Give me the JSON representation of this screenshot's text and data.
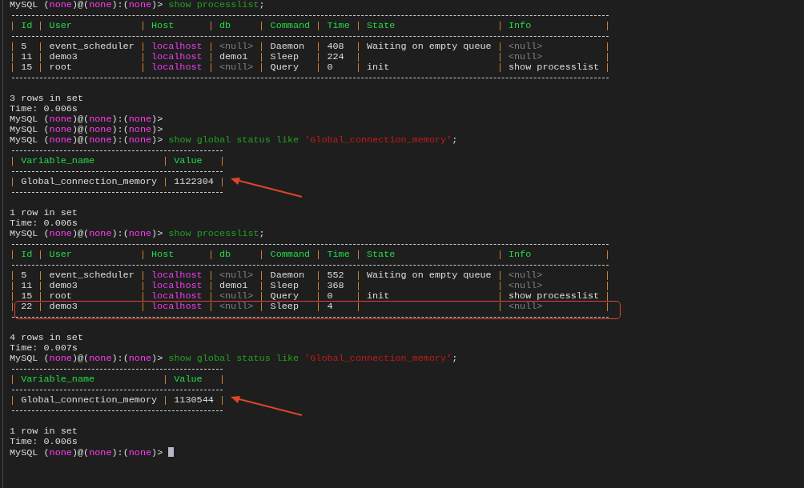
{
  "blocks": [
    {
      "kind": "prompt",
      "prompt": [
        {
          "text": "MySQL (",
          "kind": "plain"
        },
        {
          "text": "none",
          "kind": "value"
        },
        {
          "text": ")@(",
          "kind": "plain"
        },
        {
          "text": "none",
          "kind": "value"
        },
        {
          "text": "):(",
          "kind": "plain"
        },
        {
          "text": "none",
          "kind": "value"
        },
        {
          "text": ")> ",
          "kind": "plain"
        }
      ],
      "command": [
        {
          "text": "show processlist",
          "kind": "keyword"
        },
        {
          "text": ";",
          "kind": "plain"
        }
      ]
    },
    {
      "kind": "table",
      "columns": [
        {
          "name": "Id",
          "kind": "plain"
        },
        {
          "name": "User",
          "kind": "plain"
        },
        {
          "name": "Host",
          "kind": "host"
        },
        {
          "name": "db",
          "kind": "plain"
        },
        {
          "name": "Command",
          "kind": "plain"
        },
        {
          "name": "Time",
          "kind": "plain"
        },
        {
          "name": "State",
          "kind": "plain"
        },
        {
          "name": "Info",
          "kind": "plain"
        }
      ],
      "rows": [
        {
          "highlighted": false,
          "annotated": false,
          "cells": [
            {
              "text": "5",
              "kind": "plain"
            },
            {
              "text": "event_scheduler",
              "kind": "plain"
            },
            {
              "text": "localhost",
              "kind": "plain"
            },
            {
              "text": "<null>",
              "kind": "null"
            },
            {
              "text": "Daemon",
              "kind": "plain"
            },
            {
              "text": "408",
              "kind": "plain"
            },
            {
              "text": "Waiting on empty queue",
              "kind": "plain"
            },
            {
              "text": "<null>",
              "kind": "null"
            }
          ]
        },
        {
          "highlighted": false,
          "annotated": false,
          "cells": [
            {
              "text": "11",
              "kind": "plain"
            },
            {
              "text": "demo3",
              "kind": "plain"
            },
            {
              "text": "localhost",
              "kind": "plain"
            },
            {
              "text": "demo1",
              "kind": "plain"
            },
            {
              "text": "Sleep",
              "kind": "plain"
            },
            {
              "text": "224",
              "kind": "plain"
            },
            null,
            {
              "text": "<null>",
              "kind": "null"
            }
          ]
        },
        {
          "highlighted": false,
          "annotated": false,
          "cells": [
            {
              "text": "15",
              "kind": "plain"
            },
            {
              "text": "root",
              "kind": "plain"
            },
            {
              "text": "localhost",
              "kind": "plain"
            },
            {
              "text": "<null>",
              "kind": "null"
            },
            {
              "text": "Query",
              "kind": "plain"
            },
            {
              "text": "0",
              "kind": "plain"
            },
            {
              "text": "init",
              "kind": "plain"
            },
            {
              "text": "show processlist",
              "kind": "plain"
            }
          ]
        }
      ]
    },
    {
      "kind": "result",
      "lines": [
        "3 rows in set",
        "Time: 0.006s"
      ]
    },
    {
      "kind": "prompt",
      "prompt": [
        {
          "text": "MySQL (",
          "kind": "plain"
        },
        {
          "text": "none",
          "kind": "value"
        },
        {
          "text": ")@(",
          "kind": "plain"
        },
        {
          "text": "none",
          "kind": "value"
        },
        {
          "text": "):(",
          "kind": "plain"
        },
        {
          "text": "none",
          "kind": "value"
        },
        {
          "text": ")>",
          "kind": "plain"
        }
      ]
    },
    {
      "kind": "prompt",
      "prompt": [
        {
          "text": "MySQL (",
          "kind": "plain"
        },
        {
          "text": "none",
          "kind": "value"
        },
        {
          "text": ")@(",
          "kind": "plain"
        },
        {
          "text": "none",
          "kind": "value"
        },
        {
          "text": "):(",
          "kind": "plain"
        },
        {
          "text": "none",
          "kind": "value"
        },
        {
          "text": ")>",
          "kind": "plain"
        }
      ]
    },
    {
      "kind": "prompt",
      "prompt": [
        {
          "text": "MySQL (",
          "kind": "plain"
        },
        {
          "text": "none",
          "kind": "value"
        },
        {
          "text": ")@(",
          "kind": "plain"
        },
        {
          "text": "none",
          "kind": "value"
        },
        {
          "text": "):(",
          "kind": "plain"
        },
        {
          "text": "none",
          "kind": "value"
        },
        {
          "text": ")> ",
          "kind": "plain"
        }
      ],
      "command": [
        {
          "text": "show global status like ",
          "kind": "keyword"
        },
        {
          "text": "'Global_connection_memory'",
          "kind": "string"
        },
        {
          "text": ";",
          "kind": "plain"
        }
      ]
    },
    {
      "kind": "table",
      "columns": [
        {
          "name": "Variable_name",
          "kind": "plain"
        },
        {
          "name": "Value",
          "kind": "plain"
        }
      ],
      "rows": [
        {
          "highlighted": false,
          "annotated": true,
          "cells": [
            {
              "text": "Global_connection_memory",
              "kind": "plain"
            },
            {
              "text": "1122304",
              "kind": "plain"
            }
          ]
        }
      ]
    },
    {
      "kind": "result",
      "lines": [
        "1 row in set",
        "Time: 0.006s"
      ]
    },
    {
      "kind": "prompt",
      "prompt": [
        {
          "text": "MySQL (",
          "kind": "plain"
        },
        {
          "text": "none",
          "kind": "value"
        },
        {
          "text": ")@(",
          "kind": "plain"
        },
        {
          "text": "none",
          "kind": "value"
        },
        {
          "text": "):(",
          "kind": "plain"
        },
        {
          "text": "none",
          "kind": "value"
        },
        {
          "text": ")> ",
          "kind": "plain"
        }
      ],
      "command": [
        {
          "text": "show processlist",
          "kind": "keyword"
        },
        {
          "text": ";",
          "kind": "plain"
        }
      ]
    },
    {
      "kind": "table",
      "columns": [
        {
          "name": "Id",
          "kind": "plain"
        },
        {
          "name": "User",
          "kind": "plain"
        },
        {
          "name": "Host",
          "kind": "host"
        },
        {
          "name": "db",
          "kind": "plain"
        },
        {
          "name": "Command",
          "kind": "plain"
        },
        {
          "name": "Time",
          "kind": "plain"
        },
        {
          "name": "State",
          "kind": "plain"
        },
        {
          "name": "Info",
          "kind": "plain"
        }
      ],
      "rows": [
        {
          "highlighted": false,
          "annotated": false,
          "cells": [
            {
              "text": "5",
              "kind": "plain"
            },
            {
              "text": "event_scheduler",
              "kind": "plain"
            },
            {
              "text": "localhost",
              "kind": "plain"
            },
            {
              "text": "<null>",
              "kind": "null"
            },
            {
              "text": "Daemon",
              "kind": "plain"
            },
            {
              "text": "552",
              "kind": "plain"
            },
            {
              "text": "Waiting on empty queue",
              "kind": "plain"
            },
            {
              "text": "<null>",
              "kind": "null"
            }
          ]
        },
        {
          "highlighted": false,
          "annotated": false,
          "cells": [
            {
              "text": "11",
              "kind": "plain"
            },
            {
              "text": "demo3",
              "kind": "plain"
            },
            {
              "text": "localhost",
              "kind": "plain"
            },
            {
              "text": "demo1",
              "kind": "plain"
            },
            {
              "text": "Sleep",
              "kind": "plain"
            },
            {
              "text": "368",
              "kind": "plain"
            },
            null,
            {
              "text": "<null>",
              "kind": "null"
            }
          ]
        },
        {
          "highlighted": false,
          "annotated": false,
          "cells": [
            {
              "text": "15",
              "kind": "plain"
            },
            {
              "text": "root",
              "kind": "plain"
            },
            {
              "text": "localhost",
              "kind": "plain"
            },
            {
              "text": "<null>",
              "kind": "null"
            },
            {
              "text": "Query",
              "kind": "plain"
            },
            {
              "text": "0",
              "kind": "plain"
            },
            {
              "text": "init",
              "kind": "plain"
            },
            {
              "text": "show processlist",
              "kind": "plain"
            }
          ]
        },
        {
          "highlighted": true,
          "annotated": false,
          "cells": [
            {
              "text": "22",
              "kind": "plain"
            },
            {
              "text": "demo3",
              "kind": "plain"
            },
            {
              "text": "localhost",
              "kind": "plain"
            },
            {
              "text": "<null>",
              "kind": "null"
            },
            {
              "text": "Sleep",
              "kind": "plain"
            },
            {
              "text": "4",
              "kind": "plain"
            },
            null,
            {
              "text": "<null>",
              "kind": "null"
            }
          ]
        }
      ]
    },
    {
      "kind": "result",
      "lines": [
        "4 rows in set",
        "Time: 0.007s"
      ]
    },
    {
      "kind": "prompt",
      "prompt": [
        {
          "text": "MySQL (",
          "kind": "plain"
        },
        {
          "text": "none",
          "kind": "value"
        },
        {
          "text": ")@(",
          "kind": "plain"
        },
        {
          "text": "none",
          "kind": "value"
        },
        {
          "text": "):(",
          "kind": "plain"
        },
        {
          "text": "none",
          "kind": "value"
        },
        {
          "text": ")> ",
          "kind": "plain"
        }
      ],
      "command": [
        {
          "text": "show global status like ",
          "kind": "keyword"
        },
        {
          "text": "'Global_connection_memory'",
          "kind": "string"
        },
        {
          "text": ";",
          "kind": "plain"
        }
      ]
    },
    {
      "kind": "table",
      "columns": [
        {
          "name": "Variable_name",
          "kind": "plain"
        },
        {
          "name": "Value",
          "kind": "plain"
        }
      ],
      "rows": [
        {
          "highlighted": false,
          "annotated": true,
          "cells": [
            {
              "text": "Global_connection_memory",
              "kind": "plain"
            },
            {
              "text": "1130544",
              "kind": "plain"
            }
          ]
        }
      ]
    },
    {
      "kind": "result",
      "lines": [
        "1 row in set",
        "Time: 0.006s"
      ]
    },
    {
      "kind": "prompt",
      "cursor": true,
      "prompt": [
        {
          "text": "MySQL (",
          "kind": "plain"
        },
        {
          "text": "none",
          "kind": "value"
        },
        {
          "text": ")@(",
          "kind": "plain"
        },
        {
          "text": "none",
          "kind": "value"
        },
        {
          "text": "):(",
          "kind": "plain"
        },
        {
          "text": "none",
          "kind": "value"
        },
        {
          "text": ")> ",
          "kind": "plain"
        }
      ]
    }
  ]
}
